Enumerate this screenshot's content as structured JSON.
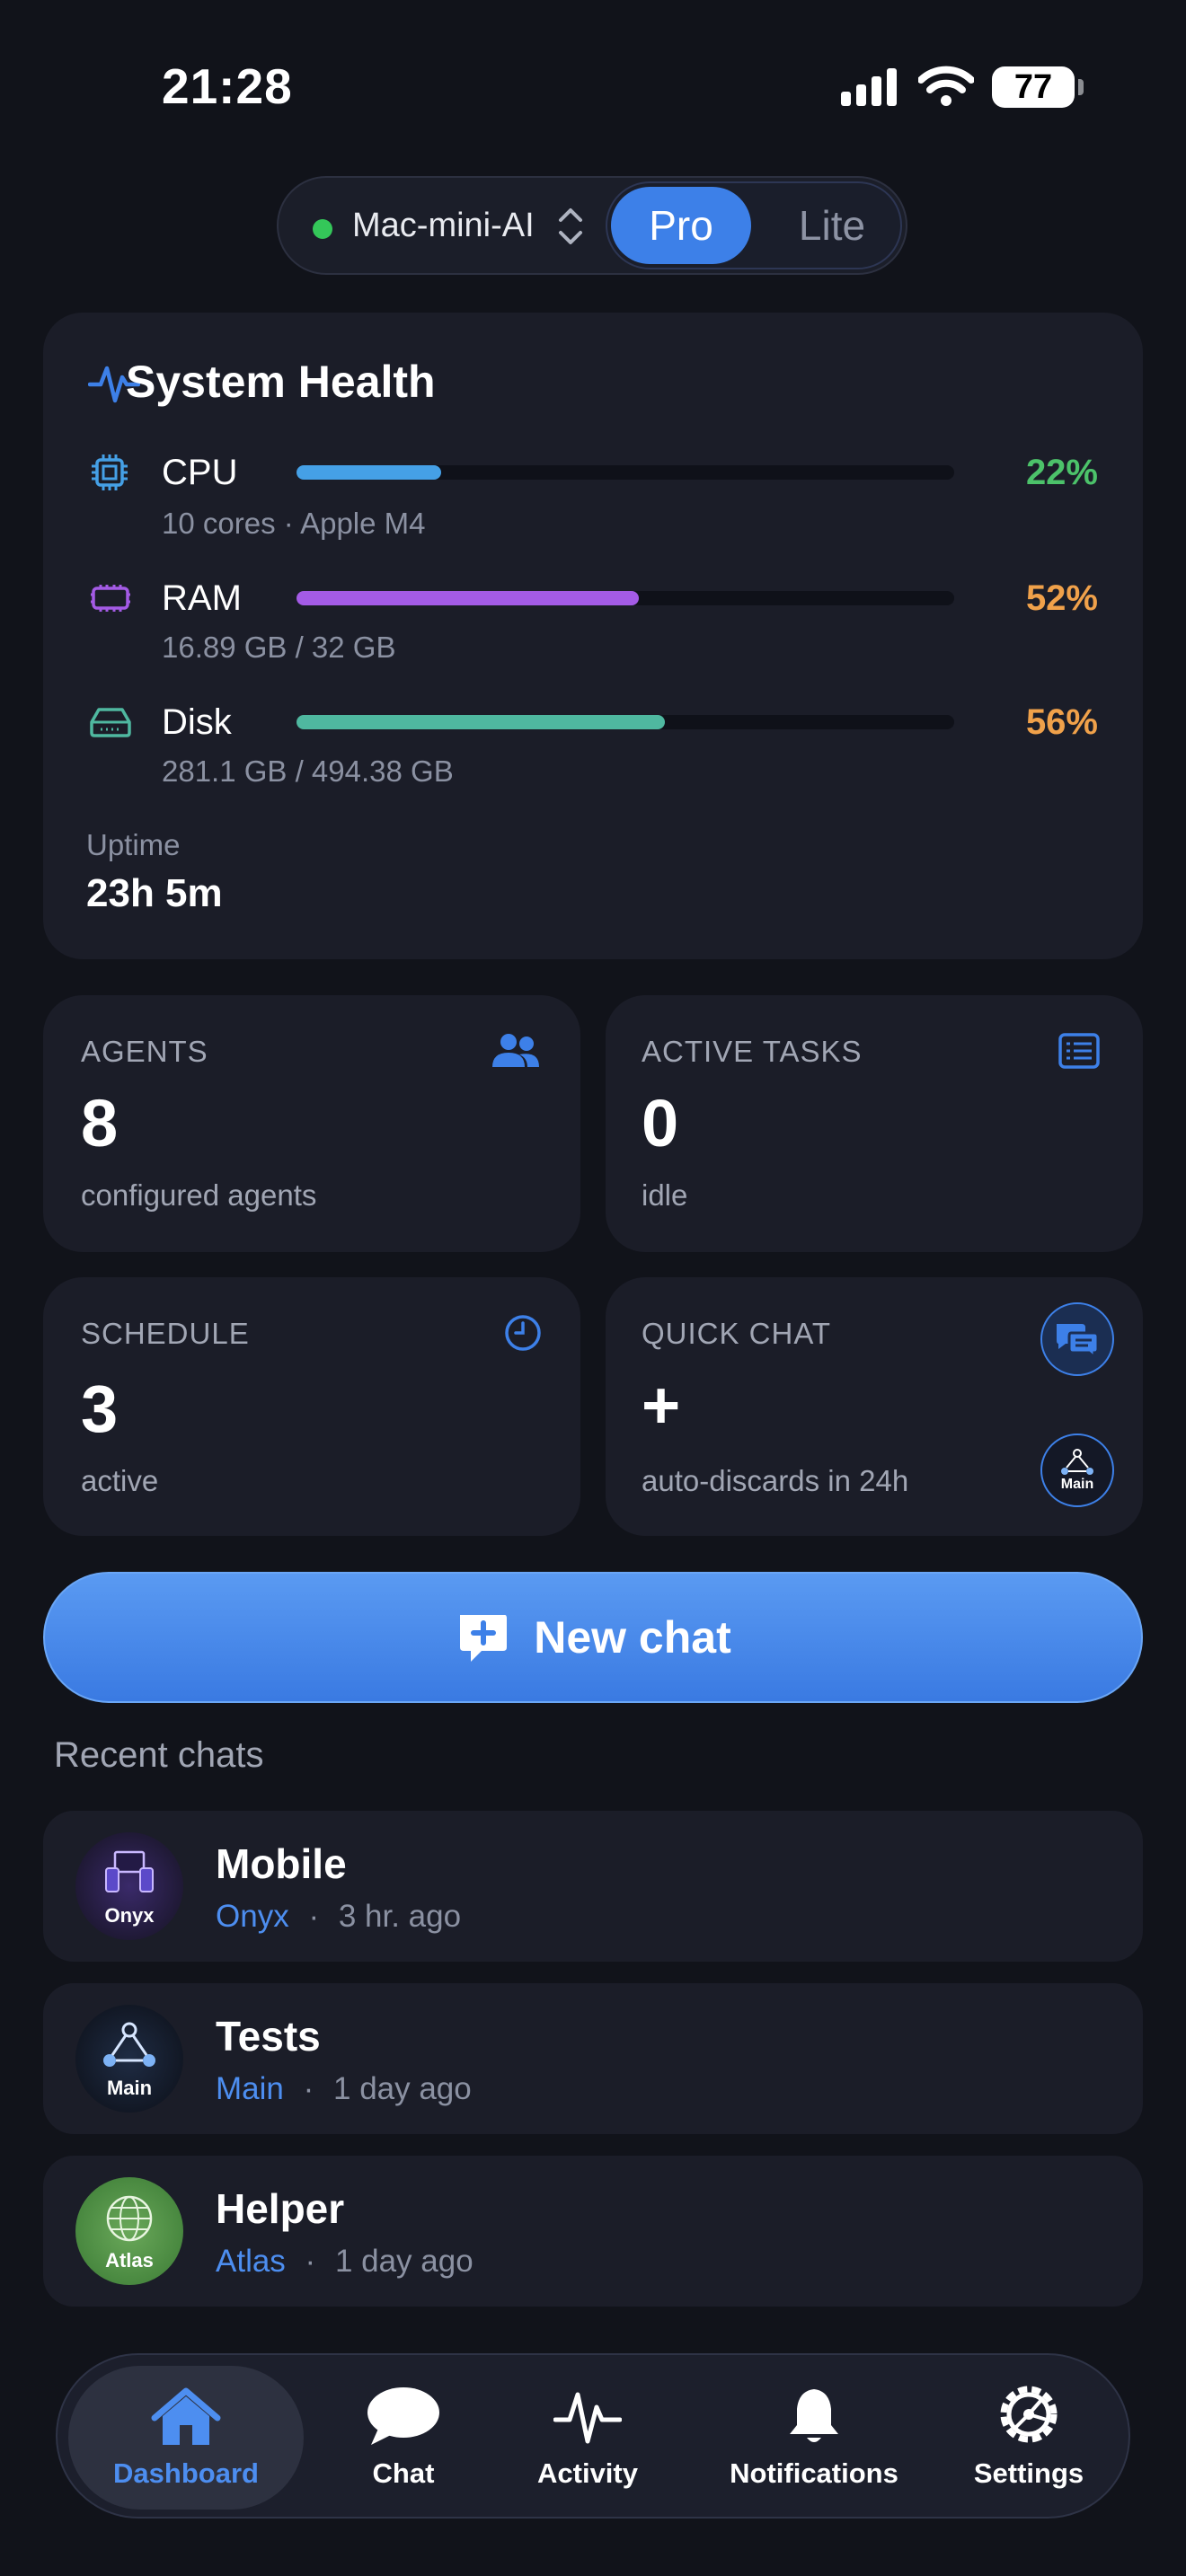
{
  "status_bar": {
    "time": "21:28",
    "battery": "77"
  },
  "selector": {
    "machine": "Mac-mini-AI",
    "modes": [
      "Pro",
      "Lite"
    ],
    "selected": "Pro"
  },
  "health": {
    "title": "System Health",
    "resources": [
      {
        "name": "CPU",
        "detail": "10 cores · Apple M4",
        "percent": "22%",
        "fill": 0.22,
        "bar_color": "#45a0e6",
        "pct_color": "#4cc26a"
      },
      {
        "name": "RAM",
        "detail": "16.89 GB / 32 GB",
        "percent": "52%",
        "fill": 0.52,
        "bar_color": "#a45be6",
        "pct_color": "#f0a14a"
      },
      {
        "name": "Disk",
        "detail": "281.1 GB / 494.38 GB",
        "percent": "56%",
        "fill": 0.56,
        "bar_color": "#4fb8a0",
        "pct_color": "#f0a14a"
      }
    ],
    "uptime_label": "Uptime",
    "uptime_value": "23h 5m"
  },
  "stats": {
    "agents": {
      "label": "AGENTS",
      "value": "8",
      "sub": "configured agents"
    },
    "tasks": {
      "label": "ACTIVE TASKS",
      "value": "0",
      "sub": "idle"
    },
    "schedule": {
      "label": "SCHEDULE",
      "value": "3",
      "sub": "active"
    },
    "quick_chat": {
      "label": "QUICK CHAT",
      "value": "+",
      "sub": "auto-discards in 24h",
      "badge": "Main"
    }
  },
  "new_chat": {
    "label": "New chat"
  },
  "recent": {
    "title": "Recent chats",
    "items": [
      {
        "title": "Mobile",
        "agent": "Onyx",
        "sep": "·",
        "time": "3 hr. ago",
        "avatar": "Onyx"
      },
      {
        "title": "Tests",
        "agent": "Main",
        "sep": "·",
        "time": "1 day ago",
        "avatar": "Main"
      },
      {
        "title": "Helper",
        "agent": "Atlas",
        "sep": "·",
        "time": "1 day ago",
        "avatar": "Atlas"
      }
    ]
  },
  "tabs": [
    {
      "label": "Dashboard",
      "icon": "house-icon",
      "active": true
    },
    {
      "label": "Chat",
      "icon": "chat-bubble-icon"
    },
    {
      "label": "Activity",
      "icon": "pulse-icon"
    },
    {
      "label": "Notifications",
      "icon": "bell-icon"
    },
    {
      "label": "Settings",
      "icon": "gear-icon"
    }
  ],
  "colors": {
    "accent": "#3d80e8",
    "background": "#11131a",
    "card": "#1b1d28"
  }
}
